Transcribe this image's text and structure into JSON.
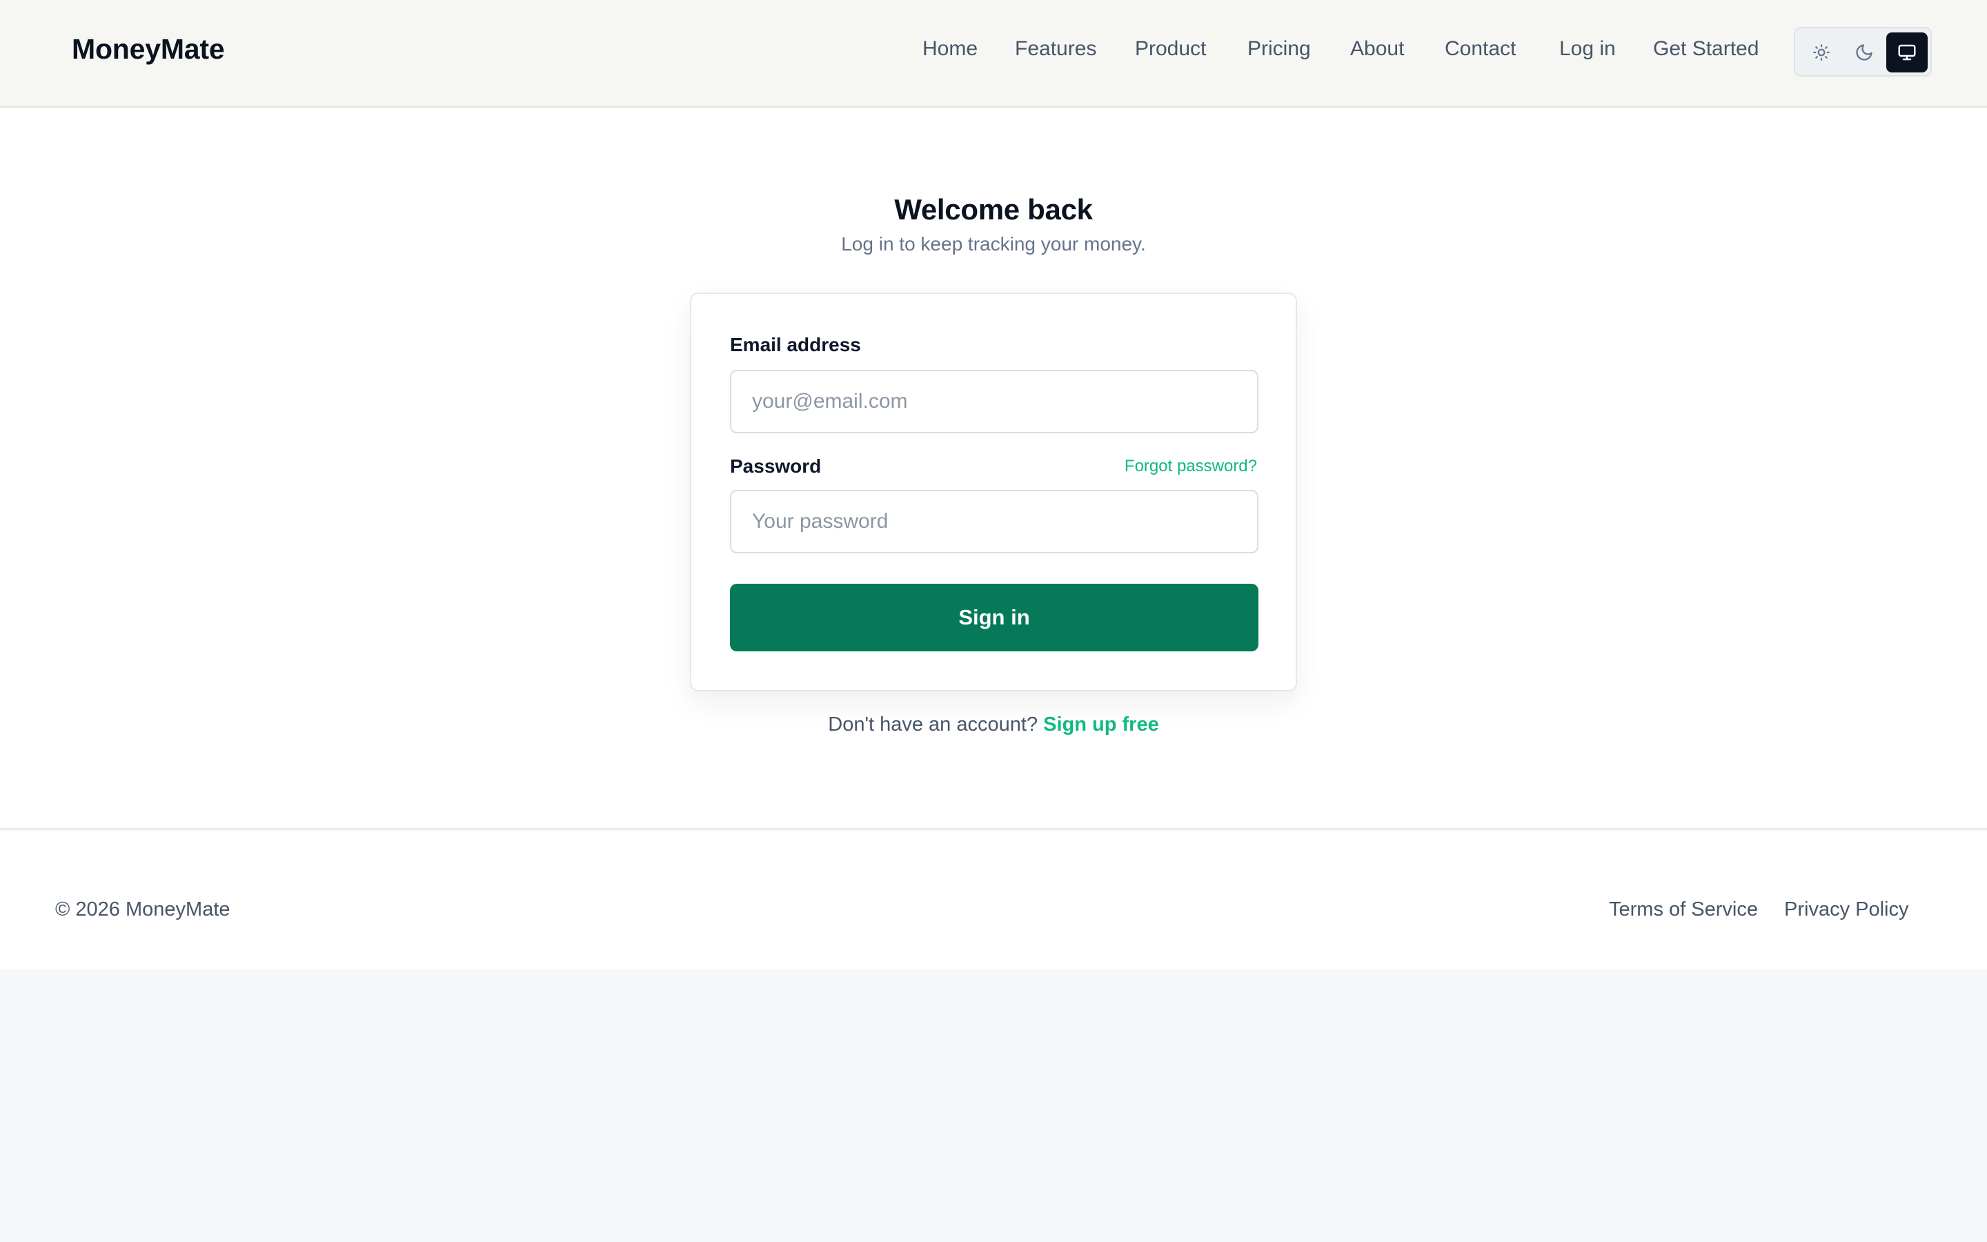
{
  "header": {
    "brand": "MoneyMate",
    "nav": [
      "Home",
      "Features",
      "Product",
      "Pricing",
      "About",
      "Contact",
      "Log in",
      "Get Started"
    ],
    "theme_options": {
      "light_icon": "sun-icon",
      "dark_icon": "moon-icon",
      "system_icon": "monitor-icon",
      "selected": "system"
    }
  },
  "login": {
    "title": "Welcome back",
    "subtitle": "Log in to keep tracking your money.",
    "email_label": "Email address",
    "email_placeholder": "your@email.com",
    "email_value": "",
    "password_label": "Password",
    "forgot_label": "Forgot password?",
    "password_placeholder": "Your password",
    "password_value": "",
    "submit_label": "Sign in",
    "signup_prompt": "Don't have an account?",
    "signup_link": "Sign up free"
  },
  "footer": {
    "copyright": "© 2026 MoneyMate",
    "links": [
      "Terms of Service",
      "Privacy Policy"
    ]
  },
  "colors": {
    "accent": "#067a58",
    "link": "#10b981",
    "header_bg": "#f6f7f3",
    "page_bg": "#f6f7fa"
  }
}
